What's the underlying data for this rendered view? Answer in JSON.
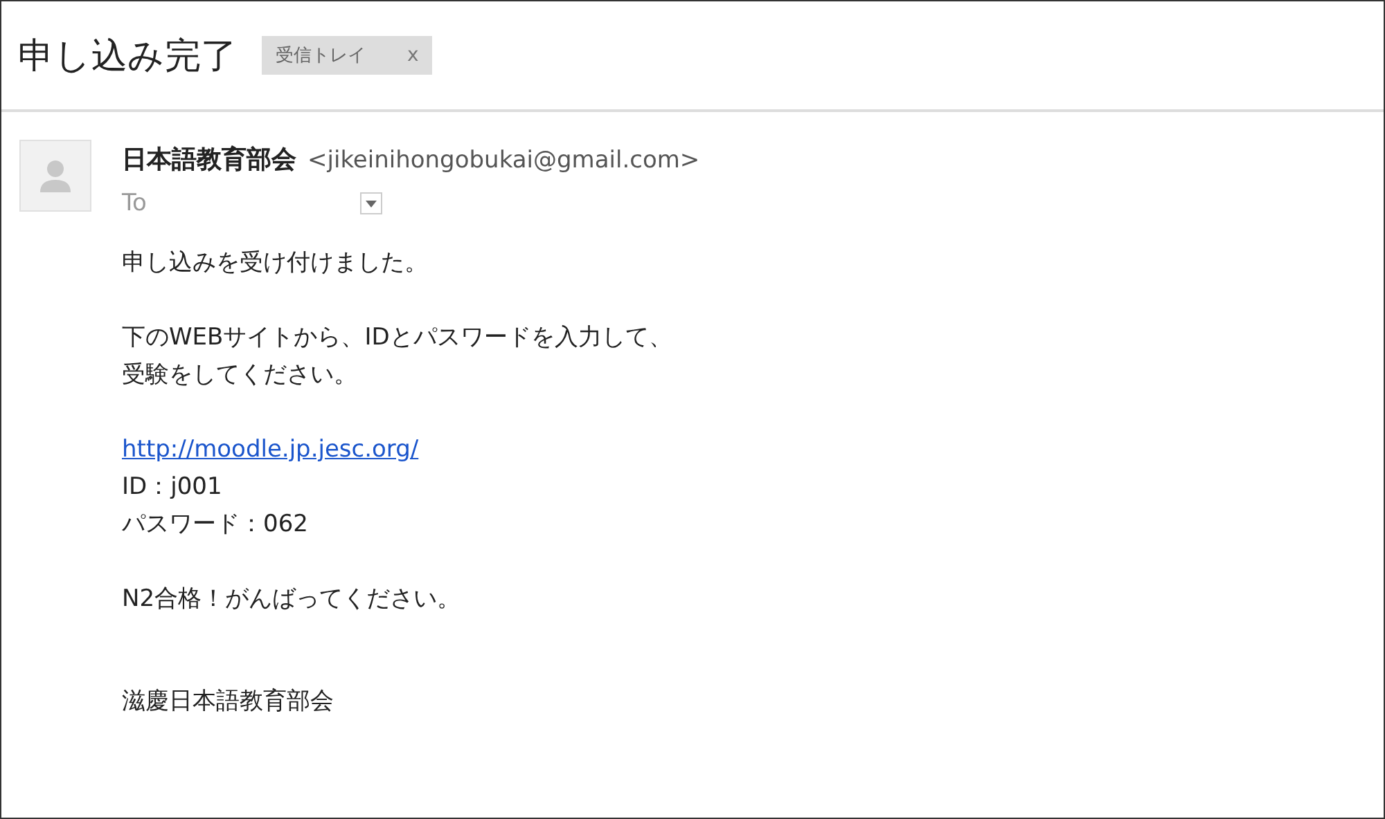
{
  "subject": {
    "title": "申し込み完了",
    "label": "受信トレイ",
    "label_close": "x"
  },
  "message": {
    "sender_name": "日本語教育部会",
    "sender_email": "<jikeinihongobukai@gmail.com>",
    "to": "To",
    "paragraphs": [
      [
        {
          "kind": "text",
          "text": "申し込みを受け付けました。"
        }
      ],
      [
        {
          "kind": "text",
          "text": "下のWEBサイトから、IDとパスワードを入力して、"
        },
        {
          "kind": "text",
          "text": "受験をしてください。"
        }
      ],
      [
        {
          "kind": "link",
          "text": "http://moodle.jp.jesc.org/"
        },
        {
          "kind": "text",
          "text": "ID：j001"
        },
        {
          "kind": "text",
          "text": "パスワード：062"
        }
      ],
      [
        {
          "kind": "text",
          "text": "N2合格！がんばってください。"
        }
      ],
      [
        {
          "kind": "text",
          "text": "滋慶日本語教育部会"
        }
      ]
    ]
  }
}
